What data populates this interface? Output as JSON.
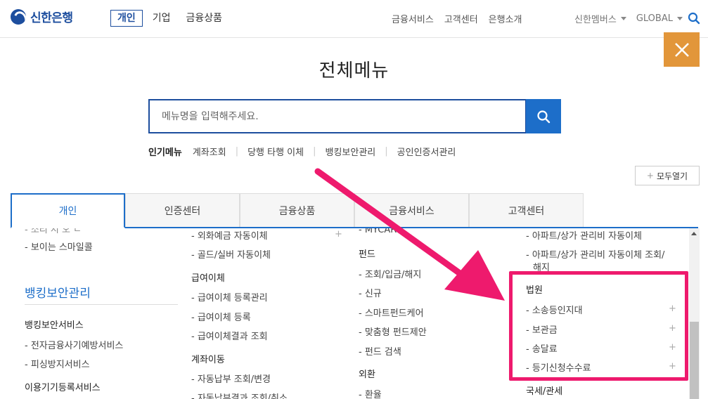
{
  "header": {
    "logo_text": "신한은행",
    "nav": [
      "개인",
      "기업",
      "금융상품"
    ],
    "util": [
      "금융서비스",
      "고객센터",
      "은행소개"
    ],
    "members": "신한멤버스",
    "global": "GLOBAL"
  },
  "page": {
    "title": "전체메뉴",
    "search_placeholder": "메뉴명을 입력해주세요.",
    "popular_label": "인기메뉴",
    "popular": [
      "계좌조회",
      "당행 타행 이체",
      "뱅킹보안관리",
      "공인인증서관리"
    ],
    "open_all": "모두열기"
  },
  "tabs": [
    "개인",
    "인증센터",
    "금융상품",
    "금융서비스",
    "고객센터"
  ],
  "col1": {
    "partial_top": "- 소리 시 오 ㄴ",
    "item1": "- 보이는 스마일콜",
    "section": "뱅킹보안관리",
    "heading1": "뱅킹보안서비스",
    "items": [
      "- 전자금융사기예방서비스",
      "- 피싱방지서비스"
    ],
    "heading2": "이용기기등록서비스"
  },
  "col2": {
    "item1": "- 외화예금 자동이체",
    "item2": "- 골드/실버 자동이체",
    "heading1": "급여이체",
    "items1": [
      "- 급여이체 등록관리",
      "- 급여이체 등록",
      "- 급여이체결과 조회"
    ],
    "heading2": "계좌이동",
    "items2": [
      "- 자동납부 조회/변경",
      "- 자동납부결과 조회/취소"
    ]
  },
  "col3": {
    "item_top": "- MYCAR",
    "heading1": "펀드",
    "items1": [
      "- 조회/입금/해지",
      "- 신규",
      "- 스마트펀드케어",
      "- 맞춤형 펀드제안",
      "- 펀드 검색"
    ],
    "heading2": "외환",
    "items2": [
      "- 환율"
    ]
  },
  "col4": {
    "item1": "- 아파트/상가 관리비 자동이체",
    "item2a": "- 아파트/상가 관리비 자동이체 조회/",
    "item2b": "해지",
    "heading1": "법원",
    "items1": [
      "- 소송등인지대",
      "- 보관금",
      "- 송달료",
      "- 등기신청수수료"
    ],
    "heading2": "국세/관세"
  },
  "colors": {
    "brand": "#1d4e9e",
    "accent": "#1d6ec9",
    "close": "#e2963a",
    "highlight": "#ee1a6d"
  }
}
